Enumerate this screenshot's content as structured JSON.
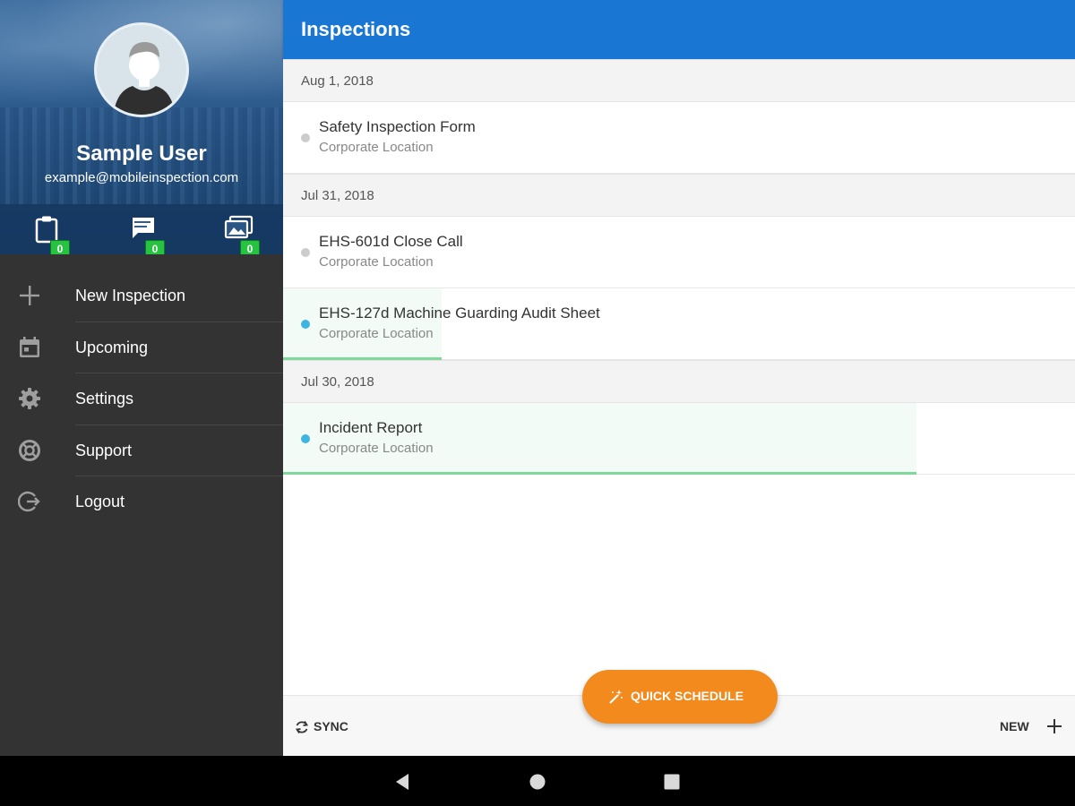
{
  "profile": {
    "name": "Sample User",
    "email": "example@mobileinspection.com",
    "counters": [
      {
        "icon": "clipboard-icon",
        "count": "0"
      },
      {
        "icon": "chat-icon",
        "count": "0"
      },
      {
        "icon": "photos-icon",
        "count": "0"
      }
    ]
  },
  "menu": {
    "items": [
      {
        "label": "New Inspection",
        "icon": "plus-icon"
      },
      {
        "label": "Upcoming",
        "icon": "calendar-icon"
      },
      {
        "label": "Settings",
        "icon": "gear-icon"
      },
      {
        "label": "Support",
        "icon": "lifebuoy-icon"
      },
      {
        "label": "Logout",
        "icon": "logout-icon"
      }
    ]
  },
  "header": {
    "title": "Inspections"
  },
  "groups": [
    {
      "date": "Aug 1, 2018",
      "items": [
        {
          "title": "Safety Inspection Form",
          "subtitle": "Corporate Location",
          "status_color": "#cccccc",
          "progress": 0
        }
      ]
    },
    {
      "date": "Jul 31, 2018",
      "items": [
        {
          "title": "EHS-601d Close Call",
          "subtitle": "Corporate Location",
          "status_color": "#cccccc",
          "progress": 0
        },
        {
          "title": "EHS-127d Machine Guarding Audit Sheet",
          "subtitle": "Corporate Location",
          "status_color": "#3fb4e0",
          "progress": 0.2
        }
      ]
    },
    {
      "date": "Jul 30, 2018",
      "items": [
        {
          "title": "Incident Report",
          "subtitle": "Corporate Location",
          "status_color": "#3fb4e0",
          "progress": 0.8
        }
      ]
    }
  ],
  "bottom_bar": {
    "sync_label": "SYNC",
    "new_label": "NEW",
    "quick_schedule_label": "QUICK SCHEDULE"
  },
  "colors": {
    "app_bar": "#1976d2",
    "sidebar": "#333333",
    "accent": "#f28a1e",
    "badge": "#27c23f",
    "progress": "#7fd99a"
  }
}
